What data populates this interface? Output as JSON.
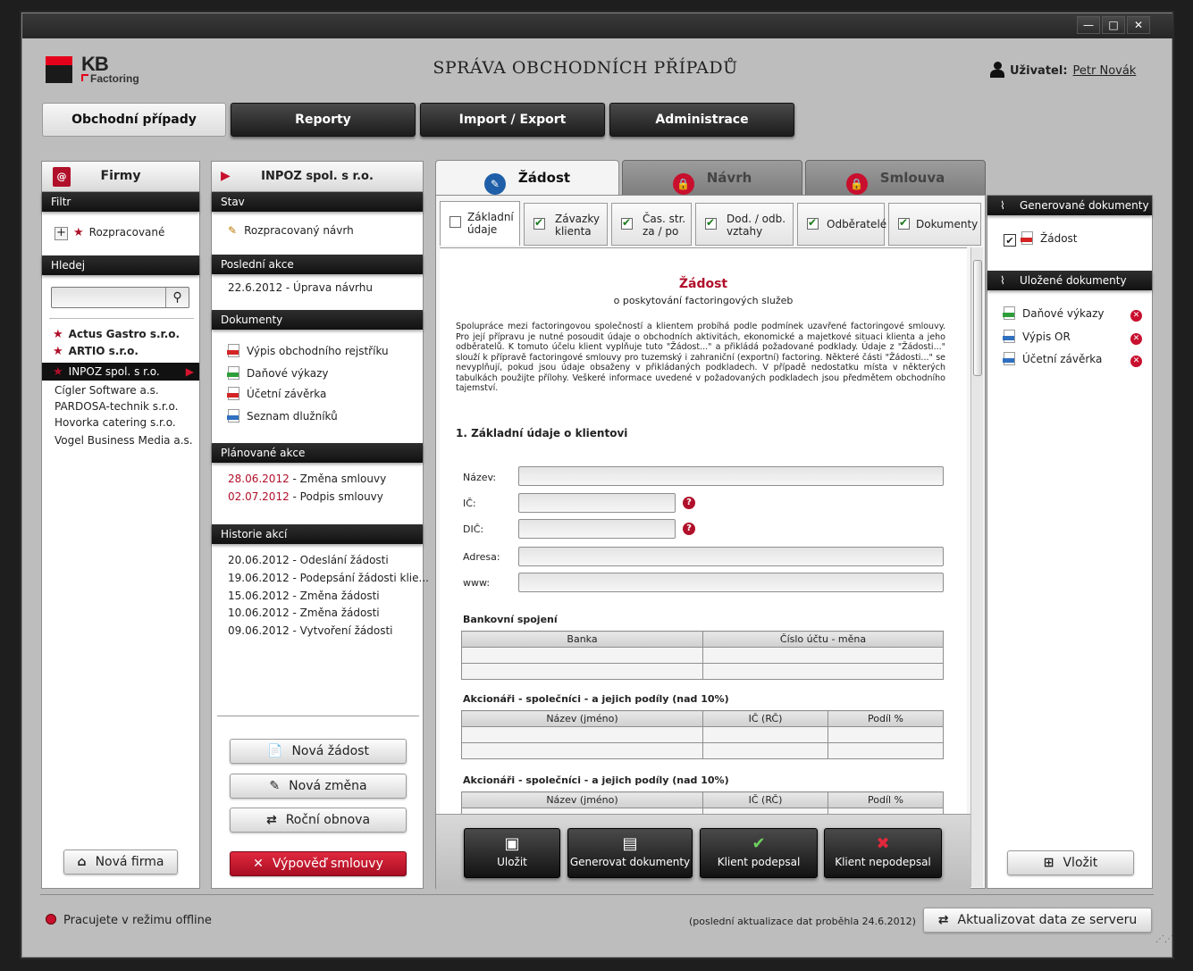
{
  "window": {
    "min": "—",
    "max": "□",
    "close": "✕"
  },
  "logo": {
    "kb": "KB",
    "factoring": "Factoring"
  },
  "app_title": "SPRÁVA OBCHODNÍCH PŘÍPADŮ",
  "user": {
    "label": "Uživatel:",
    "name": "Petr Novák"
  },
  "nav": [
    "Obchodní případy",
    "Reporty",
    "Import / Export",
    "Administrace"
  ],
  "firmy": {
    "title": "Firmy",
    "filter_hdr": "Filtr",
    "filter_item": "Rozpracované",
    "search_hdr": "Hledej",
    "search_value": "",
    "starred": [
      "Actus Gastro s.r.o.",
      "ARTIO s.r.o."
    ],
    "selected": "INPOZ spol. s r.o.",
    "others": [
      "Cígler Software a.s.",
      "PARDOSA-technik s.r.o.",
      "Hovorka catering s.r.o.",
      "Vogel Business Media a.s."
    ],
    "new_btn": "Nová firma"
  },
  "detail": {
    "title": "INPOZ spol. s r.o.",
    "stav_hdr": "Stav",
    "stav": "Rozpracovaný návrh",
    "posledni_hdr": "Poslední akce",
    "posledni": "22.6.2012  -  Úprava návrhu",
    "dokumenty_hdr": "Dokumenty",
    "dokumenty": [
      "Výpis obchodního rejstříku",
      "Daňové výkazy",
      "Účetní závěrka",
      "Seznam dlužníků"
    ],
    "planovane_hdr": "Plánované akce",
    "planovane": [
      {
        "date": "28.06.2012",
        "text": " - Změna smlouvy"
      },
      {
        "date": "02.07.2012",
        "text": " - Podpis smlouvy"
      }
    ],
    "historie_hdr": "Historie akcí",
    "historie": [
      "20.06.2012 - Odeslání žádosti",
      "19.06.2012 - Podepsání žádosti klie...",
      "15.06.2012 - Změna žádosti",
      "10.06.2012 - Změna žádosti",
      "09.06.2012 - Vytvoření žádosti"
    ],
    "btn_nova_zadost": "Nová žádost",
    "btn_nova_zmena": "Nová změna",
    "btn_rocni": "Roční obnova",
    "btn_vypoved": "Výpověď smlouvy"
  },
  "main_tabs": [
    "Žádost",
    "Návrh",
    "Smlouva"
  ],
  "sub_tabs": [
    {
      "l1": "Základní",
      "l2": "údaje",
      "checked": false
    },
    {
      "l1": "Závazky",
      "l2": "klienta",
      "checked": true
    },
    {
      "l1": "Čas. str.",
      "l2": "za / po",
      "checked": true
    },
    {
      "l1": "Dod. / odb.",
      "l2": "vztahy",
      "checked": true
    },
    {
      "l1": "Odběratelé",
      "l2": "",
      "checked": true
    },
    {
      "l1": "Dokumenty",
      "l2": "",
      "checked": true
    }
  ],
  "form": {
    "title": "Žádost",
    "subtitle": "o poskytování factoringových služeb",
    "intro": "Spolupráce mezi factoringovou společností a klientem probíhá podle podmínek uzavřené factoringové smlouvy. Pro její přípravu je nutné posoudit údaje o obchodních aktivitách, ekonomické a majetkové situaci klienta a jeho odběratelů. K tomuto účelu klient vyplňuje tuto \"Žádost...\" a přikládá požadované podklady. Údaje z \"Žádosti...\" slouží k přípravě factoringové smlouvy pro tuzemský i zahraniční (exportní) factoring. Některé části \"Žádosti...\" se nevyplňují, pokud jsou údaje obsaženy v přikládaných podkladech. V případě nedostatku místa v některých tabulkách použijte přílohy. Veškeré informace uvedené v požadovaných podkladech jsou předmětem obchodního tajemství.",
    "section1": "1. Základní údaje o klientovi",
    "labels": {
      "nazev": "Název:",
      "ic": "IČ:",
      "dic": "DIČ:",
      "adresa": "Adresa:",
      "www": "www:"
    },
    "values": {
      "nazev": "",
      "ic": "",
      "dic": "",
      "adresa": "",
      "www": ""
    },
    "help": "?",
    "bank_title": "Bankovní spojení",
    "bank_cols": [
      "Banka",
      "Číslo účtu - měna"
    ],
    "akc_title": "Akcionáři - společníci - a jejich podíly (nad 10%)",
    "akc_cols": [
      "Název (jméno)",
      "IČ (RČ)",
      "Podíl %"
    ]
  },
  "actions": [
    "Uložit",
    "Generovat dokumenty",
    "Klient podepsal",
    "Klient nepodepsal"
  ],
  "right": {
    "gen_hdr": "Generované dokumenty",
    "gen_doc": "Žádost",
    "ulozene_hdr": "Uložené dokumenty",
    "ulozene": [
      "Daňové výkazy",
      "Výpis OR",
      "Účetní závěrka"
    ],
    "vlozit": "Vložit"
  },
  "status": {
    "offline": "Pracujete v režimu offline",
    "last_update": "(poslední aktualizace dat proběhla 24.6.2012)",
    "update_btn": "Aktualizovat data ze serveru"
  }
}
